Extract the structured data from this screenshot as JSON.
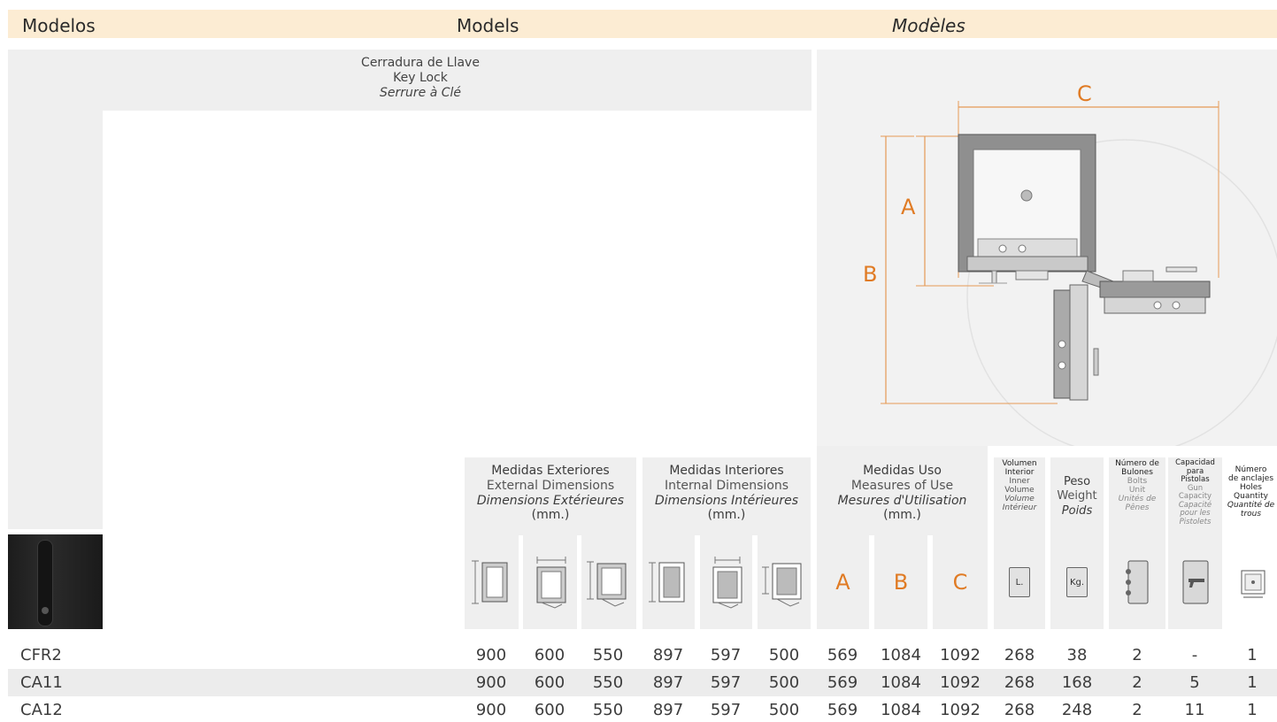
{
  "header": {
    "es": "Modelos",
    "en": "Models",
    "fr": "Modèles"
  },
  "lock_type": {
    "es": "Cerradura de Llave",
    "en": "Key Lock",
    "fr": "Serrure à Clé"
  },
  "diagram": {
    "label_a": "A",
    "label_b": "B",
    "label_c": "C"
  },
  "columns": {
    "external": {
      "es": "Medidas Exteriores",
      "en": "External Dimensions",
      "fr": "Dimensions Extérieures",
      "unit": "(mm.)"
    },
    "internal": {
      "es": "Medidas Interiores",
      "en": "Internal Dimensions",
      "fr": "Dimensions Intérieures",
      "unit": "(mm.)"
    },
    "use": {
      "es": "Medidas Uso",
      "en": "Measures of Use",
      "fr": "Mesures d'Utilisation",
      "unit": "(mm.)",
      "a": "A",
      "b": "B",
      "c": "C"
    },
    "volume": {
      "es1": "Volumen",
      "es2": "Interior",
      "en1": "Inner",
      "en2": "Volume",
      "fr1": "Volume",
      "fr2": "Intérieur",
      "icon_text": "L."
    },
    "weight": {
      "es": "Peso",
      "en": "Weight",
      "fr": "Poids",
      "icon_text": "Kg."
    },
    "bolts": {
      "es1": "Número de",
      "es2": "Bulones",
      "en1": "Bolts",
      "en2": "Unit",
      "fr1": "Unités de",
      "fr2": "Pênes"
    },
    "guns": {
      "es1": "Capacidad",
      "es2": "para",
      "es3": "Pistolas",
      "en1": "Gun",
      "en2": "Capacity",
      "fr1": "Capacité",
      "fr2": "pour les",
      "fr3": "Pistolets"
    },
    "holes": {
      "es1": "Número",
      "es2": "de anclajes",
      "en1": "Holes",
      "en2": "Quantity",
      "fr1": "Quantité de",
      "fr2": "trous"
    }
  },
  "rows": [
    {
      "name": "CFR2",
      "values": [
        "900",
        "600",
        "550",
        "897",
        "597",
        "500",
        "569",
        "1084",
        "1092",
        "268",
        "38",
        "2",
        "-",
        "1"
      ]
    },
    {
      "name": "CA11",
      "values": [
        "900",
        "600",
        "550",
        "897",
        "597",
        "500",
        "569",
        "1084",
        "1092",
        "268",
        "168",
        "2",
        "5",
        "1"
      ]
    },
    {
      "name": "CA12",
      "values": [
        "900",
        "600",
        "550",
        "897",
        "597",
        "500",
        "569",
        "1084",
        "1092",
        "268",
        "248",
        "2",
        "11",
        "1"
      ]
    }
  ]
}
